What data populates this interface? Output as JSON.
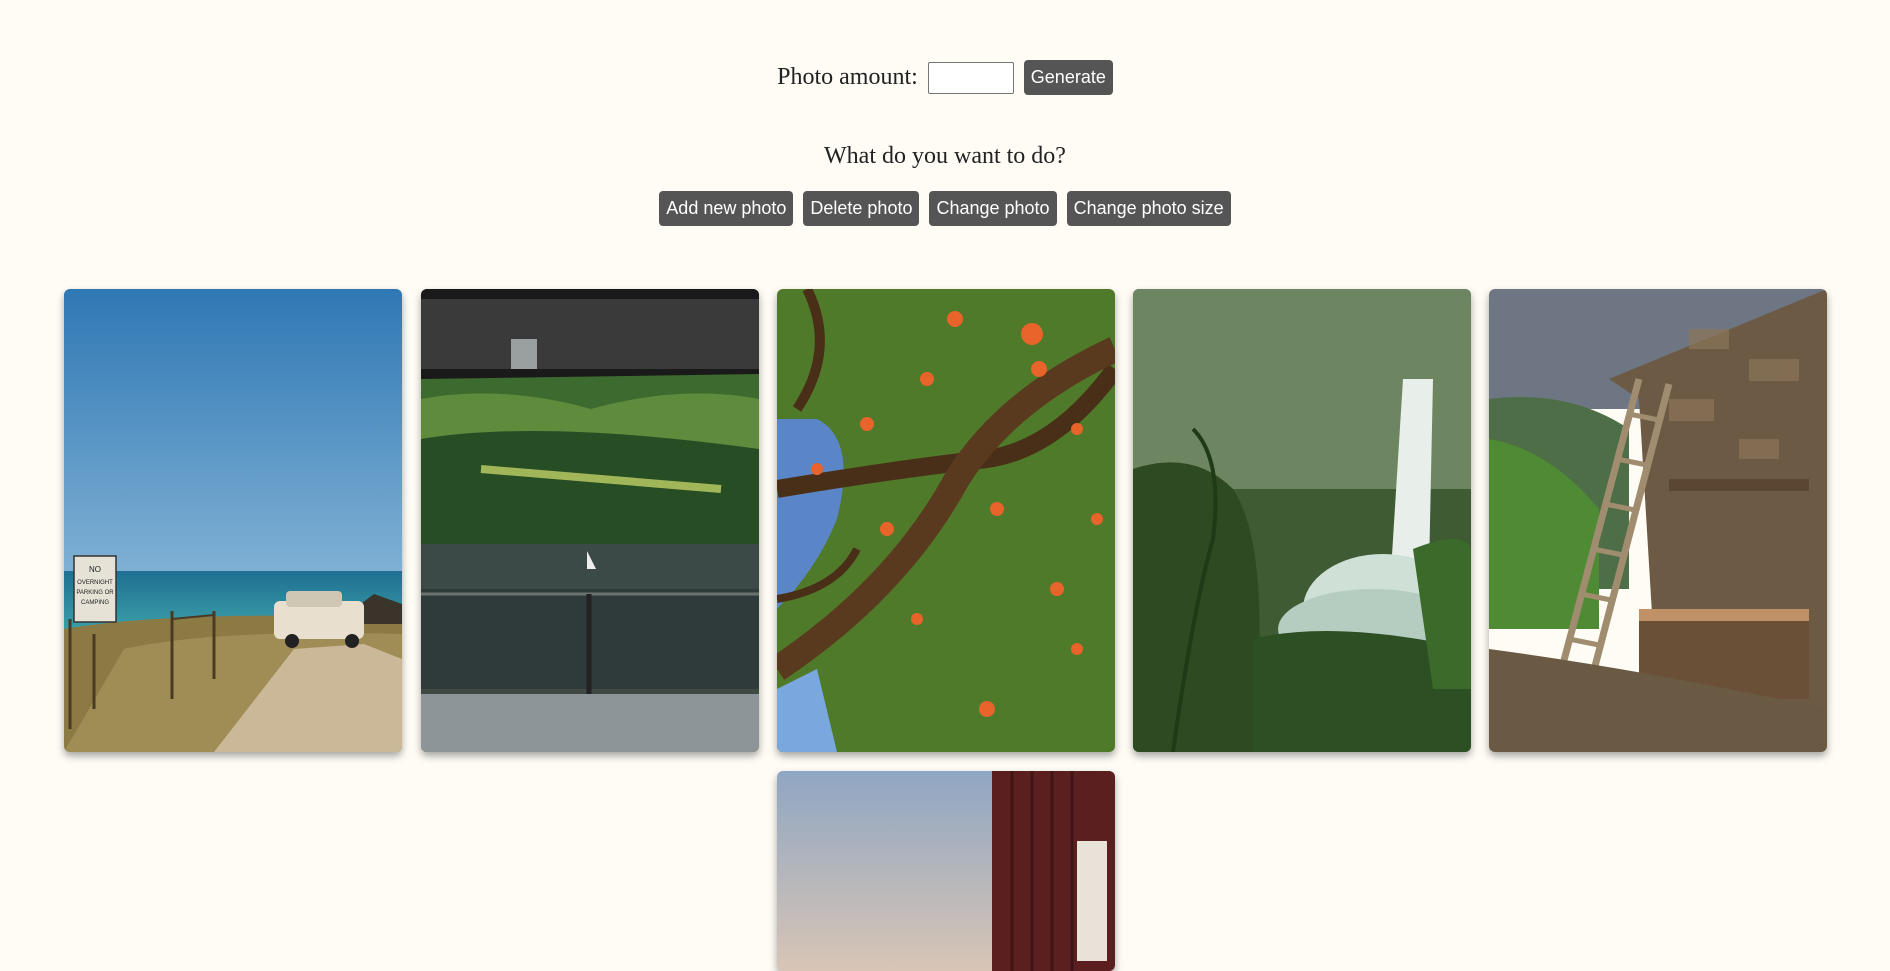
{
  "controls": {
    "amount_label": "Photo amount:",
    "amount_value": "",
    "generate_label": "Generate"
  },
  "question": "What do you want to do?",
  "actions": [
    {
      "label": "Add new photo"
    },
    {
      "label": "Delete photo"
    },
    {
      "label": "Change photo"
    },
    {
      "label": "Change photo size"
    }
  ],
  "sign_text": [
    "NO",
    "OVERNIGHT",
    "PARKING OR",
    "CAMPING"
  ]
}
